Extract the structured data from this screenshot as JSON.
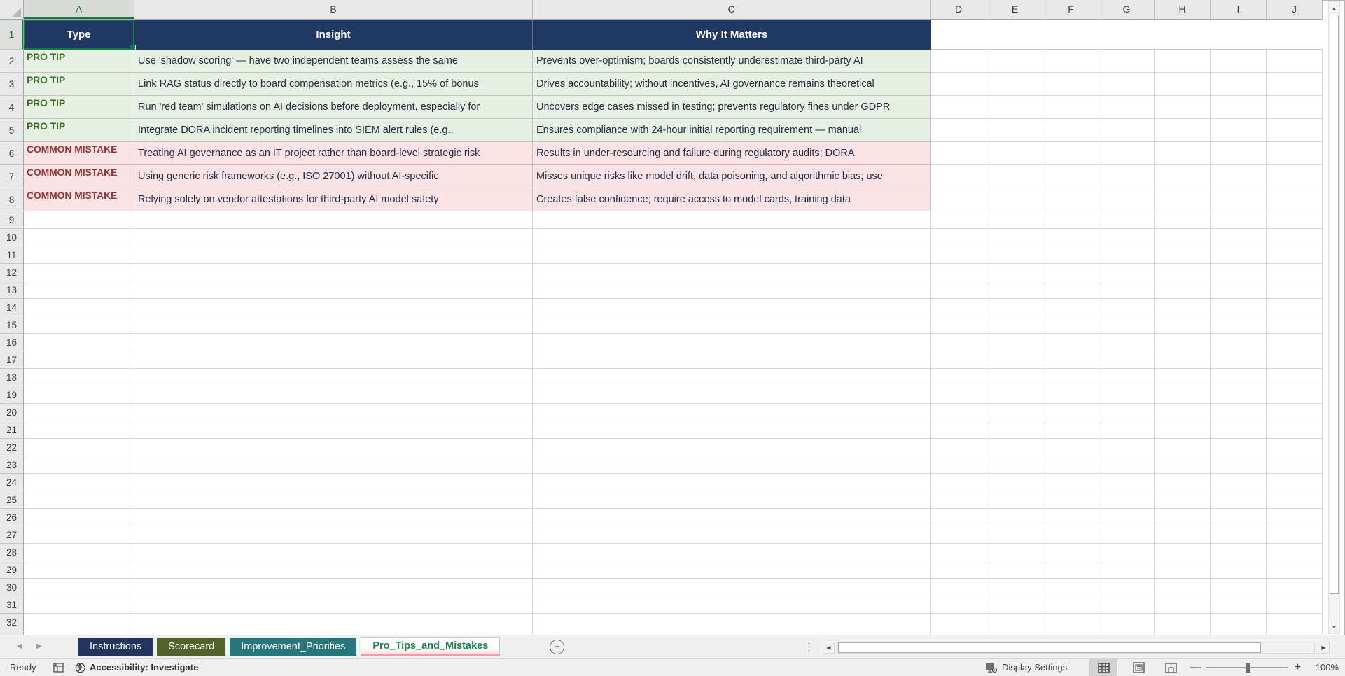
{
  "columns": [
    "A",
    "B",
    "C",
    "D",
    "E",
    "F",
    "G",
    "H",
    "I",
    "J"
  ],
  "selected_cell": {
    "column": "A",
    "row": 1
  },
  "last_visible_row": 32,
  "table": {
    "headers": [
      "Type",
      "Insight",
      "Why It Matters"
    ],
    "rows": [
      {
        "kind": "pro_tip",
        "type": "PRO TIP",
        "insight": "Use 'shadow scoring' — have two independent teams assess the same",
        "why_it_matters": "Prevents over-optimism; boards consistently underestimate third-party AI"
      },
      {
        "kind": "pro_tip",
        "type": "PRO TIP",
        "insight": "Link RAG status directly to board compensation metrics (e.g., 15% of bonus",
        "why_it_matters": "Drives accountability; without incentives, AI governance remains theoretical"
      },
      {
        "kind": "pro_tip",
        "type": "PRO TIP",
        "insight": "Run 'red team' simulations on AI decisions before deployment, especially for",
        "why_it_matters": "Uncovers edge cases missed in testing; prevents regulatory fines under GDPR"
      },
      {
        "kind": "pro_tip",
        "type": "PRO TIP",
        "insight": "Integrate DORA incident reporting timelines into SIEM alert rules (e.g.,",
        "why_it_matters": "Ensures compliance with 24-hour initial reporting requirement — manual"
      },
      {
        "kind": "common_mistake",
        "type": "COMMON MISTAKE",
        "insight": "Treating AI governance as an IT project rather than board-level strategic risk",
        "why_it_matters": "Results in under-resourcing and failure during regulatory audits; DORA"
      },
      {
        "kind": "common_mistake",
        "type": "COMMON MISTAKE",
        "insight": "Using generic risk frameworks (e.g., ISO 27001) without AI-specific",
        "why_it_matters": "Misses unique risks like model drift, data poisoning, and algorithmic bias; use"
      },
      {
        "kind": "common_mistake",
        "type": "COMMON MISTAKE",
        "insight": "Relying solely on vendor attestations for third-party AI model safety",
        "why_it_matters": "Creates false confidence; require access to model cards, training data"
      }
    ]
  },
  "sheet_tabs": [
    {
      "label": "Instructions",
      "active": false,
      "fill": "#23365F"
    },
    {
      "label": "Scorecard",
      "active": false,
      "fill": "#50632A"
    },
    {
      "label": "Improvement_Priorities",
      "active": false,
      "fill": "#26767C"
    },
    {
      "label": "Pro_Tips_and_Mistakes",
      "active": true,
      "fill": null
    }
  ],
  "status_bar": {
    "ready_label": "Ready",
    "accessibility_label": "Accessibility: Investigate",
    "display_settings_label": "Display Settings",
    "zoom_level": "100%"
  },
  "icons": {
    "nav_left": "◀",
    "nav_right": "▶",
    "new_sheet": "+",
    "scroll_up": "▲",
    "scroll_down": "▼",
    "scroll_left": "◀",
    "scroll_right": "▶",
    "zoom_out": "—",
    "zoom_in": "+",
    "splitter": "⋮"
  },
  "colors": {
    "header_fill": "#1F3864",
    "header_text": "#FFFFFF",
    "pro_tip_fill": "#E6F1E4",
    "pro_tip_text": "#3E6B28",
    "mistake_fill": "#FBE3E5",
    "mistake_text": "#943634",
    "cell_text": "#242E3E",
    "gridline": "#D6D6D6",
    "selection_green": "#1F7244",
    "active_tab_text": "#1D8348",
    "active_tab_underline": "#EE9CA6"
  }
}
